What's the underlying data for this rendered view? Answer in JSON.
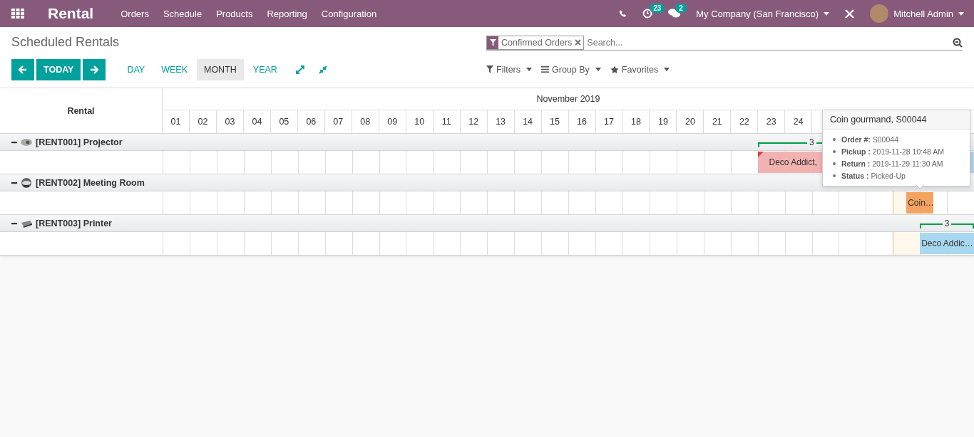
{
  "navbar": {
    "app": "Rental",
    "menus": [
      "Orders",
      "Schedule",
      "Products",
      "Reporting",
      "Configuration"
    ],
    "activity_count": "23",
    "message_count": "2",
    "company": "My Company (San Francisco)",
    "user": "Mitchell Admin"
  },
  "control_panel": {
    "title": "Scheduled Rentals",
    "today": "TODAY",
    "scales": [
      {
        "label": "DAY",
        "selected": false
      },
      {
        "label": "WEEK",
        "selected": false
      },
      {
        "label": "MONTH",
        "selected": true
      },
      {
        "label": "YEAR",
        "selected": false
      }
    ],
    "facet": "Confirmed Orders",
    "search": {
      "placeholder": "Search..."
    },
    "menus": [
      {
        "kind": "filter",
        "label": "Filters"
      },
      {
        "kind": "group",
        "label": "Group By"
      },
      {
        "kind": "favorite",
        "label": "Favorites"
      }
    ]
  },
  "gantt": {
    "row_header": "Rental",
    "month": "November 2019",
    "days": [
      {
        "label": "01",
        "today": false
      },
      {
        "label": "02",
        "today": false
      },
      {
        "label": "03",
        "today": false
      },
      {
        "label": "04",
        "today": false
      },
      {
        "label": "05",
        "today": false
      },
      {
        "label": "06",
        "today": false
      },
      {
        "label": "07",
        "today": false
      },
      {
        "label": "08",
        "today": false
      },
      {
        "label": "09",
        "today": false
      },
      {
        "label": "10",
        "today": false
      },
      {
        "label": "11",
        "today": false
      },
      {
        "label": "12",
        "today": false
      },
      {
        "label": "13",
        "today": false
      },
      {
        "label": "14",
        "today": false
      },
      {
        "label": "15",
        "today": false
      },
      {
        "label": "16",
        "today": false
      },
      {
        "label": "17",
        "today": false
      },
      {
        "label": "18",
        "today": false
      },
      {
        "label": "19",
        "today": false
      },
      {
        "label": "20",
        "today": false
      },
      {
        "label": "21",
        "today": false
      },
      {
        "label": "22",
        "today": false
      },
      {
        "label": "23",
        "today": false
      },
      {
        "label": "24",
        "today": false
      },
      {
        "today": false
      },
      {
        "today": false
      },
      {
        "today": false
      },
      {
        "today": true
      },
      {
        "today": false
      },
      {
        "today": false
      }
    ],
    "groups": [
      {
        "kind": "projector",
        "name": "[RENT001] Projector",
        "expanded": true,
        "totals": [
          {
            "count": "3"
          }
        ],
        "pills": [
          {
            "label": "Deco Addict,",
            "color": "#f2b2b2",
            "late": true
          },
          {
            "color": "#a8d8f0",
            "late": false
          }
        ]
      },
      {
        "kind": "room",
        "name": "[RENT002] Meeting Room",
        "expanded": true,
        "pills": [
          {
            "label": "Coin…",
            "color": "#f4a460",
            "late": false
          }
        ]
      },
      {
        "kind": "printer",
        "name": "[RENT003] Printer",
        "expanded": true,
        "totals": [
          {
            "count": "3"
          }
        ],
        "pills": [
          {
            "label": "Deco Addic…",
            "color": "#a8d8f0",
            "late": false
          }
        ]
      }
    ],
    "tooltip": {
      "title": "Coin gourmand, S00044",
      "lines": [
        "**Order #:** S00044",
        "**Pickup :** 2019-11-28 10:48 AM",
        "**Return :** 2019-11-29 11:30 AM",
        "**Status :** Picked-Up"
      ]
    }
  }
}
